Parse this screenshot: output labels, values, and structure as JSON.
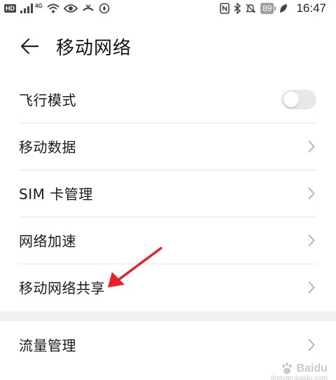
{
  "statusbar": {
    "hd_badge": "HD",
    "network_type": "4G",
    "battery_level": "89",
    "time": "16:47"
  },
  "header": {
    "title": "移动网络"
  },
  "settings": [
    {
      "label": "飞行模式",
      "control": "toggle",
      "toggle_on": false
    },
    {
      "label": "移动数据",
      "control": "chevron"
    },
    {
      "label": "SIM 卡管理",
      "control": "chevron"
    },
    {
      "label": "网络加速",
      "control": "chevron"
    },
    {
      "label": "移动网络共享",
      "control": "chevron"
    }
  ],
  "settings2": [
    {
      "label": "流量管理",
      "control": "chevron"
    }
  ],
  "watermark": {
    "brand": "Baidu",
    "sub": "jingyan.baidu.com"
  },
  "colors": {
    "annotation_arrow": "#e8202a",
    "divider_band": "#f1f1f1",
    "toggle_off": "#e8e8e8"
  }
}
